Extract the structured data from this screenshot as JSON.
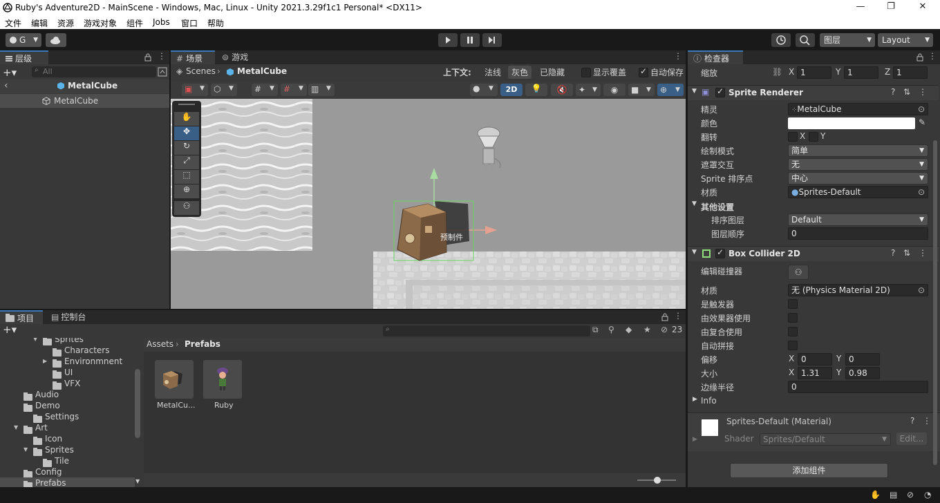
{
  "titlebar": {
    "title": "Ruby's Adventure2D - MainScene - Windows, Mac, Linux - Unity 2021.3.29f1c1 Personal* <DX11>",
    "minimize": "—",
    "maximize": "❐",
    "close": "✕"
  },
  "menubar": [
    "文件",
    "编辑",
    "资源",
    "游戏对象",
    "组件",
    "Jobs",
    "窗口",
    "帮助"
  ],
  "toolbar": {
    "account": "G",
    "layers": "图层",
    "layout": "Layout"
  },
  "hierarchy": {
    "tab": "层级",
    "search_placeholder": "All",
    "prefab_title": "MetalCube",
    "item": "MetalCube"
  },
  "scene": {
    "tab_scene": "场景",
    "tab_game": "游戏",
    "breadcrumb_root": "Scenes",
    "breadcrumb_item": "MetalCube",
    "context_label": "上下文:",
    "mode_normal": "法线",
    "mode_gray": "灰色",
    "mode_hidden": "已隐藏",
    "show_overlay": "显示覆盖",
    "autosave": "自动保存",
    "btn_2d": "2D",
    "prefab_label": "预制件"
  },
  "inspector": {
    "tab": "检查器",
    "scale_label": "缩放",
    "scale": {
      "x": "1",
      "y": "1",
      "z": "1"
    },
    "sprite_renderer": {
      "title": "Sprite Renderer",
      "sprite_label": "精灵",
      "sprite": "MetalCube",
      "color_label": "颜色",
      "flip_label": "翻转",
      "flip_x": "X",
      "flip_y": "Y",
      "draw_mode_label": "绘制模式",
      "draw_mode": "简单",
      "mask_label": "遮罩交互",
      "mask": "无",
      "sort_point_label": "Sprite 排序点",
      "sort_point": "中心",
      "material_label": "材质",
      "material": "Sprites-Default",
      "other_label": "其他设置",
      "sorting_layer_label": "排序图层",
      "sorting_layer": "Default",
      "order_label": "图层顺序",
      "order": "0"
    },
    "box_collider": {
      "title": "Box Collider 2D",
      "edit_label": "编辑碰撞器",
      "material_label": "材质",
      "material": "无 (Physics Material 2D)",
      "trigger_label": "是触发器",
      "effector_label": "由效果器使用",
      "composite_label": "由复合使用",
      "autotile_label": "自动拼接",
      "offset_label": "偏移",
      "offset_x": "0",
      "offset_y": "0",
      "size_label": "大小",
      "size_x": "1.31",
      "size_y": "0.98",
      "edge_label": "边缘半径",
      "edge": "0",
      "info": "Info"
    },
    "material": {
      "title": "Sprites-Default (Material)",
      "shader_label": "Shader",
      "shader": "Sprites/Default",
      "edit": "Edit..."
    },
    "add_component": "添加组件"
  },
  "project": {
    "tab_project": "项目",
    "tab_console": "控制台",
    "hidden_count": "23",
    "breadcrumb_root": "Assets",
    "breadcrumb_current": "Prefabs",
    "tree": [
      {
        "label": "Sprites",
        "indent": 62,
        "arrow": "▼"
      },
      {
        "label": "Characters",
        "indent": 76,
        "arrow": ""
      },
      {
        "label": "Environmnent",
        "indent": 76,
        "arrow": "▶"
      },
      {
        "label": "UI",
        "indent": 76,
        "arrow": ""
      },
      {
        "label": "VFX",
        "indent": 76,
        "arrow": ""
      },
      {
        "label": "Audio",
        "indent": 34,
        "arrow": ""
      },
      {
        "label": "Demo",
        "indent": 34,
        "arrow": ""
      },
      {
        "label": "Settings",
        "indent": 48,
        "arrow": ""
      },
      {
        "label": "Art",
        "indent": 34,
        "arrow": "▼"
      },
      {
        "label": "Icon",
        "indent": 48,
        "arrow": ""
      },
      {
        "label": "Sprites",
        "indent": 48,
        "arrow": "▼"
      },
      {
        "label": "Tile",
        "indent": 62,
        "arrow": ""
      },
      {
        "label": "Config",
        "indent": 34,
        "arrow": ""
      },
      {
        "label": "Prefabs",
        "indent": 34,
        "arrow": ""
      }
    ],
    "assets": [
      "MetalCu...",
      "Ruby"
    ]
  },
  "colors": {
    "accent": "#3a79bb",
    "panel": "#383838",
    "selection": "#2c5d87"
  }
}
